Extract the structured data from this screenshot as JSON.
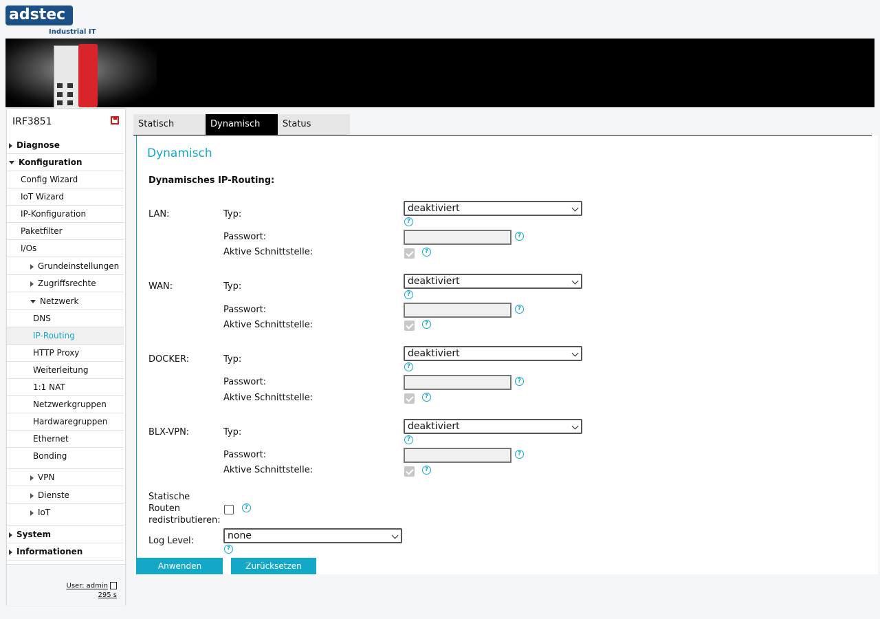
{
  "header": {
    "logo_text": "adstec",
    "logo_sub": "Industrial IT"
  },
  "sidebar": {
    "device_title": "IRF3851",
    "items": [
      {
        "label": "Diagnose"
      },
      {
        "label": "Konfiguration"
      },
      {
        "label": "Config Wizard"
      },
      {
        "label": "IoT Wizard"
      },
      {
        "label": "IP-Konfiguration"
      },
      {
        "label": "Paketfilter"
      },
      {
        "label": "I/Os"
      },
      {
        "label": "Grundeinstellungen"
      },
      {
        "label": "Zugriffsrechte"
      },
      {
        "label": "Netzwerk"
      },
      {
        "label": "DNS"
      },
      {
        "label": "IP-Routing"
      },
      {
        "label": "HTTP Proxy"
      },
      {
        "label": "Weiterleitung"
      },
      {
        "label": "1:1 NAT"
      },
      {
        "label": "Netzwerkgruppen"
      },
      {
        "label": "Hardwaregruppen"
      },
      {
        "label": "Ethernet"
      },
      {
        "label": "Bonding"
      },
      {
        "label": "VPN"
      },
      {
        "label": "Dienste"
      },
      {
        "label": "IoT"
      },
      {
        "label": "System"
      },
      {
        "label": "Informationen"
      }
    ],
    "user_label": "User: admin",
    "session_timer": "295 s"
  },
  "tabs": [
    {
      "label": "Statisch"
    },
    {
      "label": "Dynamisch"
    },
    {
      "label": "Status"
    }
  ],
  "content": {
    "heading": "Dynamisch",
    "subheading": "Dynamisches IP-Routing:",
    "field_labels": {
      "type": "Typ:",
      "password": "Passwort:",
      "active_interface": "Aktive Schnittstelle:"
    },
    "interfaces": [
      {
        "label": "LAN:",
        "type_value": "deaktiviert"
      },
      {
        "label": "WAN:",
        "type_value": "deaktiviert"
      },
      {
        "label": "DOCKER:",
        "type_value": "deaktiviert"
      },
      {
        "label": "BLX-VPN:",
        "type_value": "deaktiviert"
      }
    ],
    "redistribute_label_1": "Statische",
    "redistribute_label_2": "Routen",
    "redistribute_label_3": "redistributieren:",
    "log_level_label": "Log Level:",
    "log_level_value": "none",
    "help_glyph": "?",
    "apply_button": "Anwenden",
    "reset_button": "Zurücksetzen"
  },
  "colors": {
    "accent": "#14a8c8",
    "brand": "#1b4f86",
    "banner": "#000000"
  }
}
